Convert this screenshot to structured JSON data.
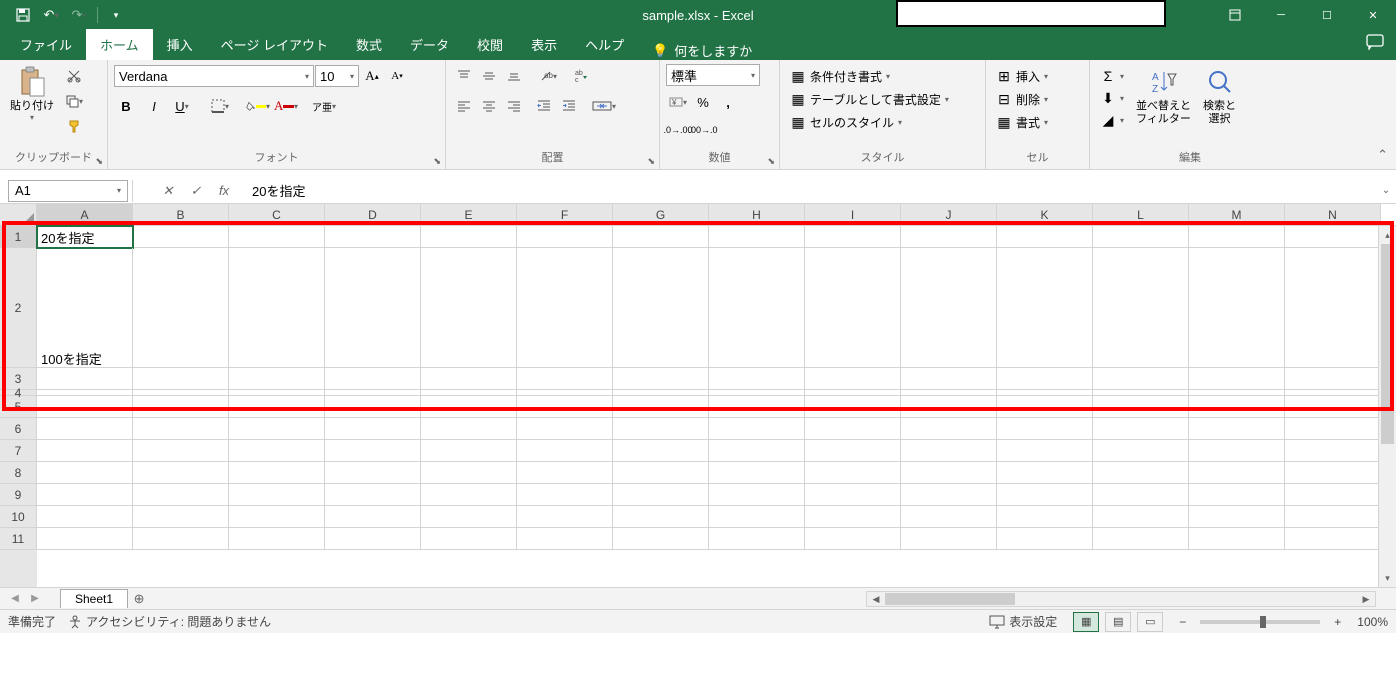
{
  "title": "sample.xlsx - Excel",
  "tabs": {
    "file": "ファイル",
    "home": "ホーム",
    "insert": "挿入",
    "page_layout": "ページ レイアウト",
    "formulas": "数式",
    "data": "データ",
    "review": "校閲",
    "view": "表示",
    "help": "ヘルプ",
    "tell_me": "何をしますか"
  },
  "ribbon": {
    "clipboard": {
      "label": "クリップボード",
      "paste": "貼り付け"
    },
    "font": {
      "label": "フォント",
      "name": "Verdana",
      "size": "10"
    },
    "alignment": {
      "label": "配置"
    },
    "number": {
      "label": "数値",
      "format": "標準"
    },
    "styles": {
      "label": "スタイル",
      "conditional": "条件付き書式",
      "table": "テーブルとして書式設定",
      "cell": "セルのスタイル"
    },
    "cells": {
      "label": "セル",
      "insert": "挿入",
      "delete": "削除",
      "format": "書式"
    },
    "editing": {
      "label": "編集",
      "sort": "並べ替えと\nフィルター",
      "find": "検索と\n選択"
    }
  },
  "name_box": "A1",
  "formula": "20を指定",
  "columns": [
    "A",
    "B",
    "C",
    "D",
    "E",
    "F",
    "G",
    "H",
    "I",
    "J",
    "K",
    "L",
    "M",
    "N"
  ],
  "rows": {
    "heights": [
      22,
      120,
      22,
      6,
      22,
      22,
      22,
      22,
      22,
      22,
      22,
      12
    ],
    "labels": [
      "1",
      "2",
      "3",
      "4",
      "5",
      "6",
      "7",
      "8",
      "9",
      "10",
      "11"
    ]
  },
  "cells": {
    "A1": "20を指定",
    "A2": "100を指定"
  },
  "sheet": {
    "name": "Sheet1"
  },
  "status": {
    "ready": "準備完了",
    "accessibility": "アクセシビリティ: 問題ありません",
    "display_settings": "表示設定",
    "zoom": "100%"
  }
}
